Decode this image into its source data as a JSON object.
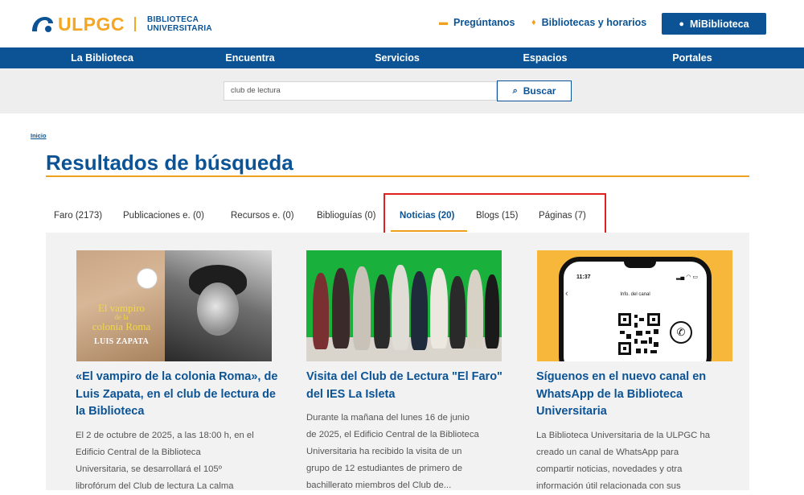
{
  "header": {
    "logo_name": "ULPGC",
    "logo_sub_1": "BIBLIOTECA",
    "logo_sub_2": "UNIVERSITARIA",
    "ask_label": "Pregúntanos",
    "hours_label": "Bibliotecas y horarios",
    "mybib_label": "MiBiblioteca"
  },
  "nav": {
    "items": [
      "La Biblioteca",
      "Encuentra",
      "Servicios",
      "Espacios",
      "Portales"
    ]
  },
  "search": {
    "value": "club de lectura",
    "button_label": "Buscar"
  },
  "breadcrumb": "Inicio",
  "page_title": "Resultados de búsqueda",
  "tabs": [
    {
      "label": "Faro (2173)"
    },
    {
      "label": "Publicaciones e. (0)"
    },
    {
      "label": "Recursos e. (0)"
    },
    {
      "label": "Biblioguías (0)"
    },
    {
      "label": "Noticias (20)",
      "active": true
    },
    {
      "label": "Blogs (15)"
    },
    {
      "label": "Páginas (7)"
    }
  ],
  "cards": [
    {
      "title": "«El vampiro de la colonia Roma», de Luis Zapata, en el club de lectura de la Biblioteca",
      "lines": [
        "El 2 de octubre de 2025, a las 18:00 h, en el",
        "Edificio Central de la Biblioteca",
        "Universitaria, se desarrollará el 105º",
        "librofórum del Club de lectura La calma"
      ],
      "image": {
        "book_title_1": "El vampiro",
        "book_title_2": "de la",
        "book_title_3": "colonia Roma",
        "book_author": "LUIS ZAPATA"
      }
    },
    {
      "title": "Visita del Club de Lectura \"El Faro\" del IES La Isleta",
      "lines": [
        "Durante la mañana del lunes 16 de junio",
        "de 2025, el Edificio Central de la Biblioteca",
        "Universitaria ha recibido la visita de un",
        "grupo de 12 estudiantes de primero de",
        "bachillerato miembros del Club de..."
      ]
    },
    {
      "title": "Síguenos en el nuevo canal en WhatsApp de la Biblioteca Universitaria",
      "lines": [
        "La Biblioteca Universitaria de la ULPGC ha",
        "creado un canal de WhatsApp para",
        "compartir noticias, novedades y otra",
        "información útil relacionada con sus"
      ],
      "image": {
        "phone_time": "11:37",
        "phone_header": "Info. del canal"
      }
    }
  ],
  "colors": {
    "brand_blue": "#0b5394",
    "accent_orange": "#f0a020",
    "highlight_red": "#e02020"
  }
}
